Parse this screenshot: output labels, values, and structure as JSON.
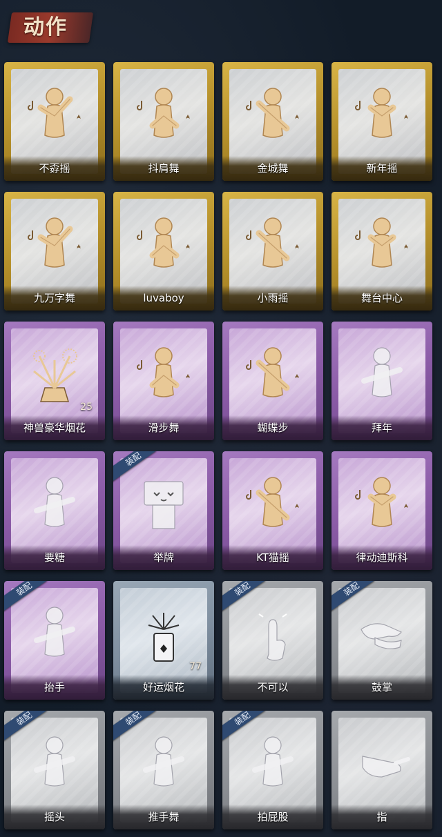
{
  "header": {
    "title": "动作"
  },
  "items": [
    {
      "label": "不孬摇",
      "rarity": "gold",
      "icon": "dance-pose-icon",
      "equipped": false,
      "count": ""
    },
    {
      "label": "抖肩舞",
      "rarity": "gold",
      "icon": "dance-pose-icon",
      "equipped": false,
      "count": ""
    },
    {
      "label": "金城舞",
      "rarity": "gold",
      "icon": "dance-pose-icon",
      "equipped": false,
      "count": ""
    },
    {
      "label": "新年摇",
      "rarity": "gold",
      "icon": "dance-pose-icon",
      "equipped": false,
      "count": ""
    },
    {
      "label": "九万字舞",
      "rarity": "gold",
      "icon": "dance-pose-icon",
      "equipped": false,
      "count": ""
    },
    {
      "label": "luvaboy",
      "rarity": "gold",
      "icon": "dance-pose-icon",
      "equipped": false,
      "count": ""
    },
    {
      "label": "小雨摇",
      "rarity": "gold",
      "icon": "dance-pose-icon",
      "equipped": false,
      "count": ""
    },
    {
      "label": "舞台中心",
      "rarity": "gold",
      "icon": "dance-pose-icon",
      "equipped": false,
      "count": ""
    },
    {
      "label": "神兽豪华烟花",
      "rarity": "purple",
      "icon": "fireworks-icon",
      "equipped": false,
      "count": "25"
    },
    {
      "label": "滑步舞",
      "rarity": "purple",
      "icon": "dance-pose-icon",
      "equipped": false,
      "count": ""
    },
    {
      "label": "蝴蝶步",
      "rarity": "purple",
      "icon": "dance-pose-icon",
      "equipped": false,
      "count": ""
    },
    {
      "label": "拜年",
      "rarity": "purple",
      "icon": "bow-pose-icon",
      "equipped": false,
      "count": ""
    },
    {
      "label": "要糖",
      "rarity": "purple",
      "icon": "ask-pose-icon",
      "equipped": false,
      "count": ""
    },
    {
      "label": "举牌",
      "rarity": "purple",
      "icon": "sign-board-icon",
      "equipped": true,
      "count": ""
    },
    {
      "label": "KT猫摇",
      "rarity": "purple",
      "icon": "dance-pose-icon",
      "equipped": false,
      "count": ""
    },
    {
      "label": "律动迪斯科",
      "rarity": "purple",
      "icon": "dance-pose-icon",
      "equipped": false,
      "count": ""
    },
    {
      "label": "抬手",
      "rarity": "purple",
      "icon": "raise-hand-icon",
      "equipped": true,
      "count": ""
    },
    {
      "label": "好运烟花",
      "rarity": "blue",
      "icon": "firework-can-icon",
      "equipped": false,
      "count": "77"
    },
    {
      "label": "不可以",
      "rarity": "gray",
      "icon": "finger-wag-icon",
      "equipped": true,
      "count": ""
    },
    {
      "label": "鼓掌",
      "rarity": "gray",
      "icon": "clap-hands-icon",
      "equipped": true,
      "count": ""
    },
    {
      "label": "摇头",
      "rarity": "gray",
      "icon": "shake-head-icon",
      "equipped": true,
      "count": ""
    },
    {
      "label": "推手舞",
      "rarity": "gray",
      "icon": "push-hands-icon",
      "equipped": true,
      "count": ""
    },
    {
      "label": "拍屁股",
      "rarity": "gray",
      "icon": "pat-butt-icon",
      "equipped": true,
      "count": ""
    },
    {
      "label": "指",
      "rarity": "gray",
      "icon": "point-hand-icon",
      "equipped": false,
      "count": ""
    }
  ],
  "badges": {
    "equipped_label": "装配"
  },
  "colors": {
    "gold": "#c9a43a",
    "purple": "#8a5aa6",
    "blue": "#7f8fa0",
    "gray": "#8c8f94",
    "equip_badge": "#2f4a72",
    "title_banner": "#8a3226"
  }
}
